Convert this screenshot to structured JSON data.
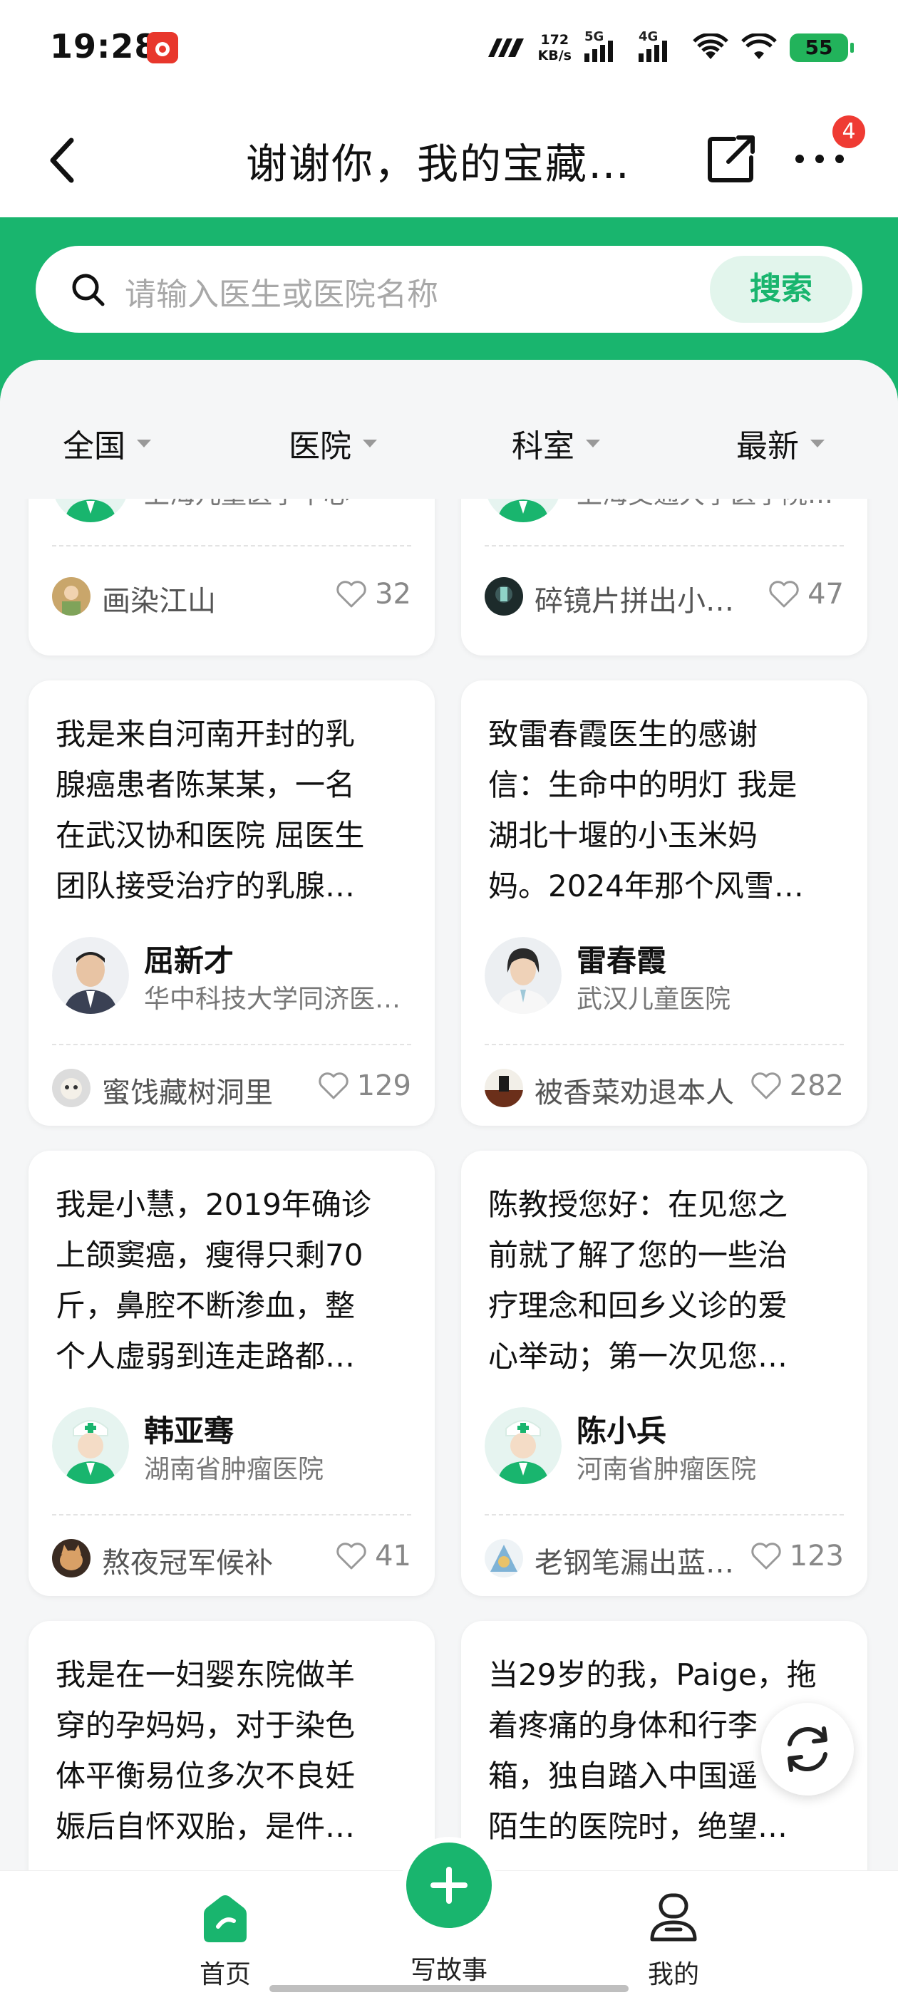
{
  "status_bar": {
    "time": "19:28",
    "net_speed_value": "172",
    "net_speed_unit": "KB/s",
    "signal_1": "5G",
    "signal_2": "4G",
    "battery": "55"
  },
  "header": {
    "title": "谢谢你，我的宝藏…",
    "badge_count": "4"
  },
  "search": {
    "placeholder": "请输入医生或医院名称",
    "button_label": "搜索"
  },
  "filters": [
    "全国",
    "医院",
    "科室",
    "最新"
  ],
  "cards": [
    {
      "story_lines": [],
      "doctor_name": "",
      "hospital": "上海儿童医学中心",
      "user": "画染江山",
      "likes": "32"
    },
    {
      "story_lines": [],
      "doctor_name": "",
      "hospital": "上海交通大学医学院…",
      "user": "碎镜片拼出小…",
      "likes": "47"
    },
    {
      "story_lines": [
        "我是来自河南开封的乳",
        "腺癌患者陈某某，一名",
        "在武汉协和医院 屈医生",
        "团队接受治疗的乳腺…"
      ],
      "doctor_name": "屈新才",
      "hospital": "华中科技大学同济医…",
      "user": "蜜饯藏树洞里",
      "likes": "129"
    },
    {
      "story_lines": [
        "致雷春霞医生的感谢",
        "信：生命中的明灯 我是",
        "湖北十堰的小玉米妈",
        "妈。2024年那个风雪…"
      ],
      "doctor_name": "雷春霞",
      "hospital": "武汉儿童医院",
      "user": "被香菜劝退本人",
      "likes": "282"
    },
    {
      "story_lines": [
        "我是小慧，2019年确诊",
        "上颌窦癌，瘦得只剩70",
        "斤，鼻腔不断渗血，整",
        "个人虚弱到连走路都…"
      ],
      "doctor_name": "韩亚骞",
      "hospital": "湖南省肿瘤医院",
      "user": "熬夜冠军候补",
      "likes": "41"
    },
    {
      "story_lines": [
        "陈教授您好：在见您之",
        "前就了解了您的一些治",
        "疗理念和回乡义诊的爱",
        "心举动；第一次见您…"
      ],
      "doctor_name": "陈小兵",
      "hospital": "河南省肿瘤医院",
      "user": "老钢笔漏出蓝…",
      "likes": "123"
    },
    {
      "story_lines": [
        "我是在一妇婴东院做羊",
        "穿的孕妈妈，对于染色",
        "体平衡易位多次不良妊",
        "娠后自怀双胎，是件…"
      ],
      "doctor_name": "",
      "hospital": "",
      "user": "",
      "likes": ""
    },
    {
      "story_lines": [
        "当29岁的我，Paige，拖",
        "着疼痛的身体和行李",
        "箱，独自踏入中国遥",
        "陌生的医院时，绝望…"
      ],
      "doctor_name": "",
      "hospital": "",
      "user": "",
      "likes": ""
    }
  ],
  "bottom_nav": {
    "home": "首页",
    "write": "写故事",
    "mine": "我的"
  },
  "colors": {
    "brand_green": "#19b56e",
    "badge_red": "#ef3b33"
  }
}
